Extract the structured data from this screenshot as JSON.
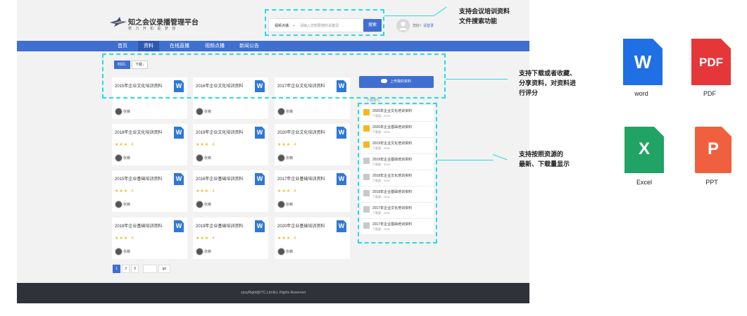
{
  "header": {
    "title": "知之会议录播管理平台",
    "subtitle": "努 力 开 机 驱 梦 想",
    "search": {
      "category": "视频点播",
      "placeholder": "请输入您想要搜的关键词",
      "button": "搜索"
    },
    "greeting": "您好！",
    "login_link": "请登录"
  },
  "nav": [
    "首页",
    "资料",
    "在线直播",
    "视频点播",
    "新闻公告"
  ],
  "active_nav": "资料",
  "filters": [
    "时间↓",
    "下载↓"
  ],
  "cards": [
    {
      "title": "2015年企业文化培训资料",
      "stars": "",
      "rating": "",
      "author": "张薇"
    },
    {
      "title": "2016年企业文化培训资料",
      "stars": "",
      "rating": "",
      "author": "张薇"
    },
    {
      "title": "2017年企业文化培训资料",
      "stars": "",
      "rating": "",
      "author": "张薇"
    },
    {
      "title": "2018年企业文化培训资料",
      "stars": "★★★",
      "rating": "4",
      "author": "张薇"
    },
    {
      "title": "2019年企业文化培训资料",
      "stars": "★★★",
      "rating": "4",
      "author": "张薇"
    },
    {
      "title": "2020年企业文化培训资料",
      "stars": "★★★",
      "rating": "4",
      "author": "张薇"
    },
    {
      "title": "2015年企业基础培训资料",
      "stars": "★★★",
      "rating": "4",
      "author": "张薇"
    },
    {
      "title": "2016年企业基础培训资料",
      "stars": "★★★",
      "rating": "4",
      "author": "张薇"
    },
    {
      "title": "2017年企业基础培训资料",
      "stars": "★★★",
      "rating": "4",
      "author": "张薇"
    },
    {
      "title": "2018年企业基础培训资料",
      "stars": "★★★",
      "rating": "4",
      "author": "张薇"
    },
    {
      "title": "2019年企业基础培训资料",
      "stars": "★★★",
      "rating": "4",
      "author": "张薇"
    },
    {
      "title": "2020年企业基础培训资料",
      "stars": "★★★",
      "rating": "4",
      "author": "张薇"
    }
  ],
  "card_icon": "W",
  "upload_button": "上传我的资料",
  "sidebar": {
    "heading": "下载排行",
    "items": [
      {
        "title": "2020年企业文化培训资料",
        "downloads": "下载量：2000",
        "badge_color": "#f5b623"
      },
      {
        "title": "2020年企业基础培训资料",
        "downloads": "下载量：2000",
        "badge_color": "#f5b623"
      },
      {
        "title": "2019年企业文化培训资料",
        "downloads": "下载量：2000",
        "badge_color": "#f5b623"
      },
      {
        "title": "2019年企业基础培训资料",
        "downloads": "下载量：2000",
        "badge_color": "#c8c8c8"
      },
      {
        "title": "2018年企业文化培训资料",
        "downloads": "下载量：2000",
        "badge_color": "#c8c8c8"
      },
      {
        "title": "2018年企业基础培训资料",
        "downloads": "下载量：2000",
        "badge_color": "#c8c8c8"
      },
      {
        "title": "2017年企业文化培训资料",
        "downloads": "下载量：2000",
        "badge_color": "#c8c8c8"
      },
      {
        "title": "2017年企业基础培训资料",
        "downloads": "下载量：2000",
        "badge_color": "#c8c8c8"
      }
    ]
  },
  "pagination": {
    "pages": [
      "1",
      "2",
      "3"
    ],
    "current": "1",
    "go_label": "go"
  },
  "footer": "cpoyRight@ITC.Ltd ALL Rights Reserved",
  "annotations": {
    "search": [
      "支持会议培训资料",
      "文件搜索功能"
    ],
    "download": [
      "支持下载或者收藏、",
      "分享资料，对资料进",
      "行评分"
    ],
    "ranking": [
      "支持按照资源的",
      "最新、下载量显示"
    ]
  },
  "file_types": [
    {
      "name": "word",
      "glyph": "W",
      "color": "#1f6fe5"
    },
    {
      "name": "PDF",
      "glyph": "PDF",
      "color": "#e5373a"
    },
    {
      "name": "Excel",
      "glyph": "X",
      "color": "#21a366"
    },
    {
      "name": "PPT",
      "glyph": "P",
      "color": "#f0603f"
    }
  ],
  "colors": {
    "primary": "#3f6fd1",
    "annotation": "#27dbe6",
    "star": "#f5b623",
    "footer": "#2f3238"
  }
}
